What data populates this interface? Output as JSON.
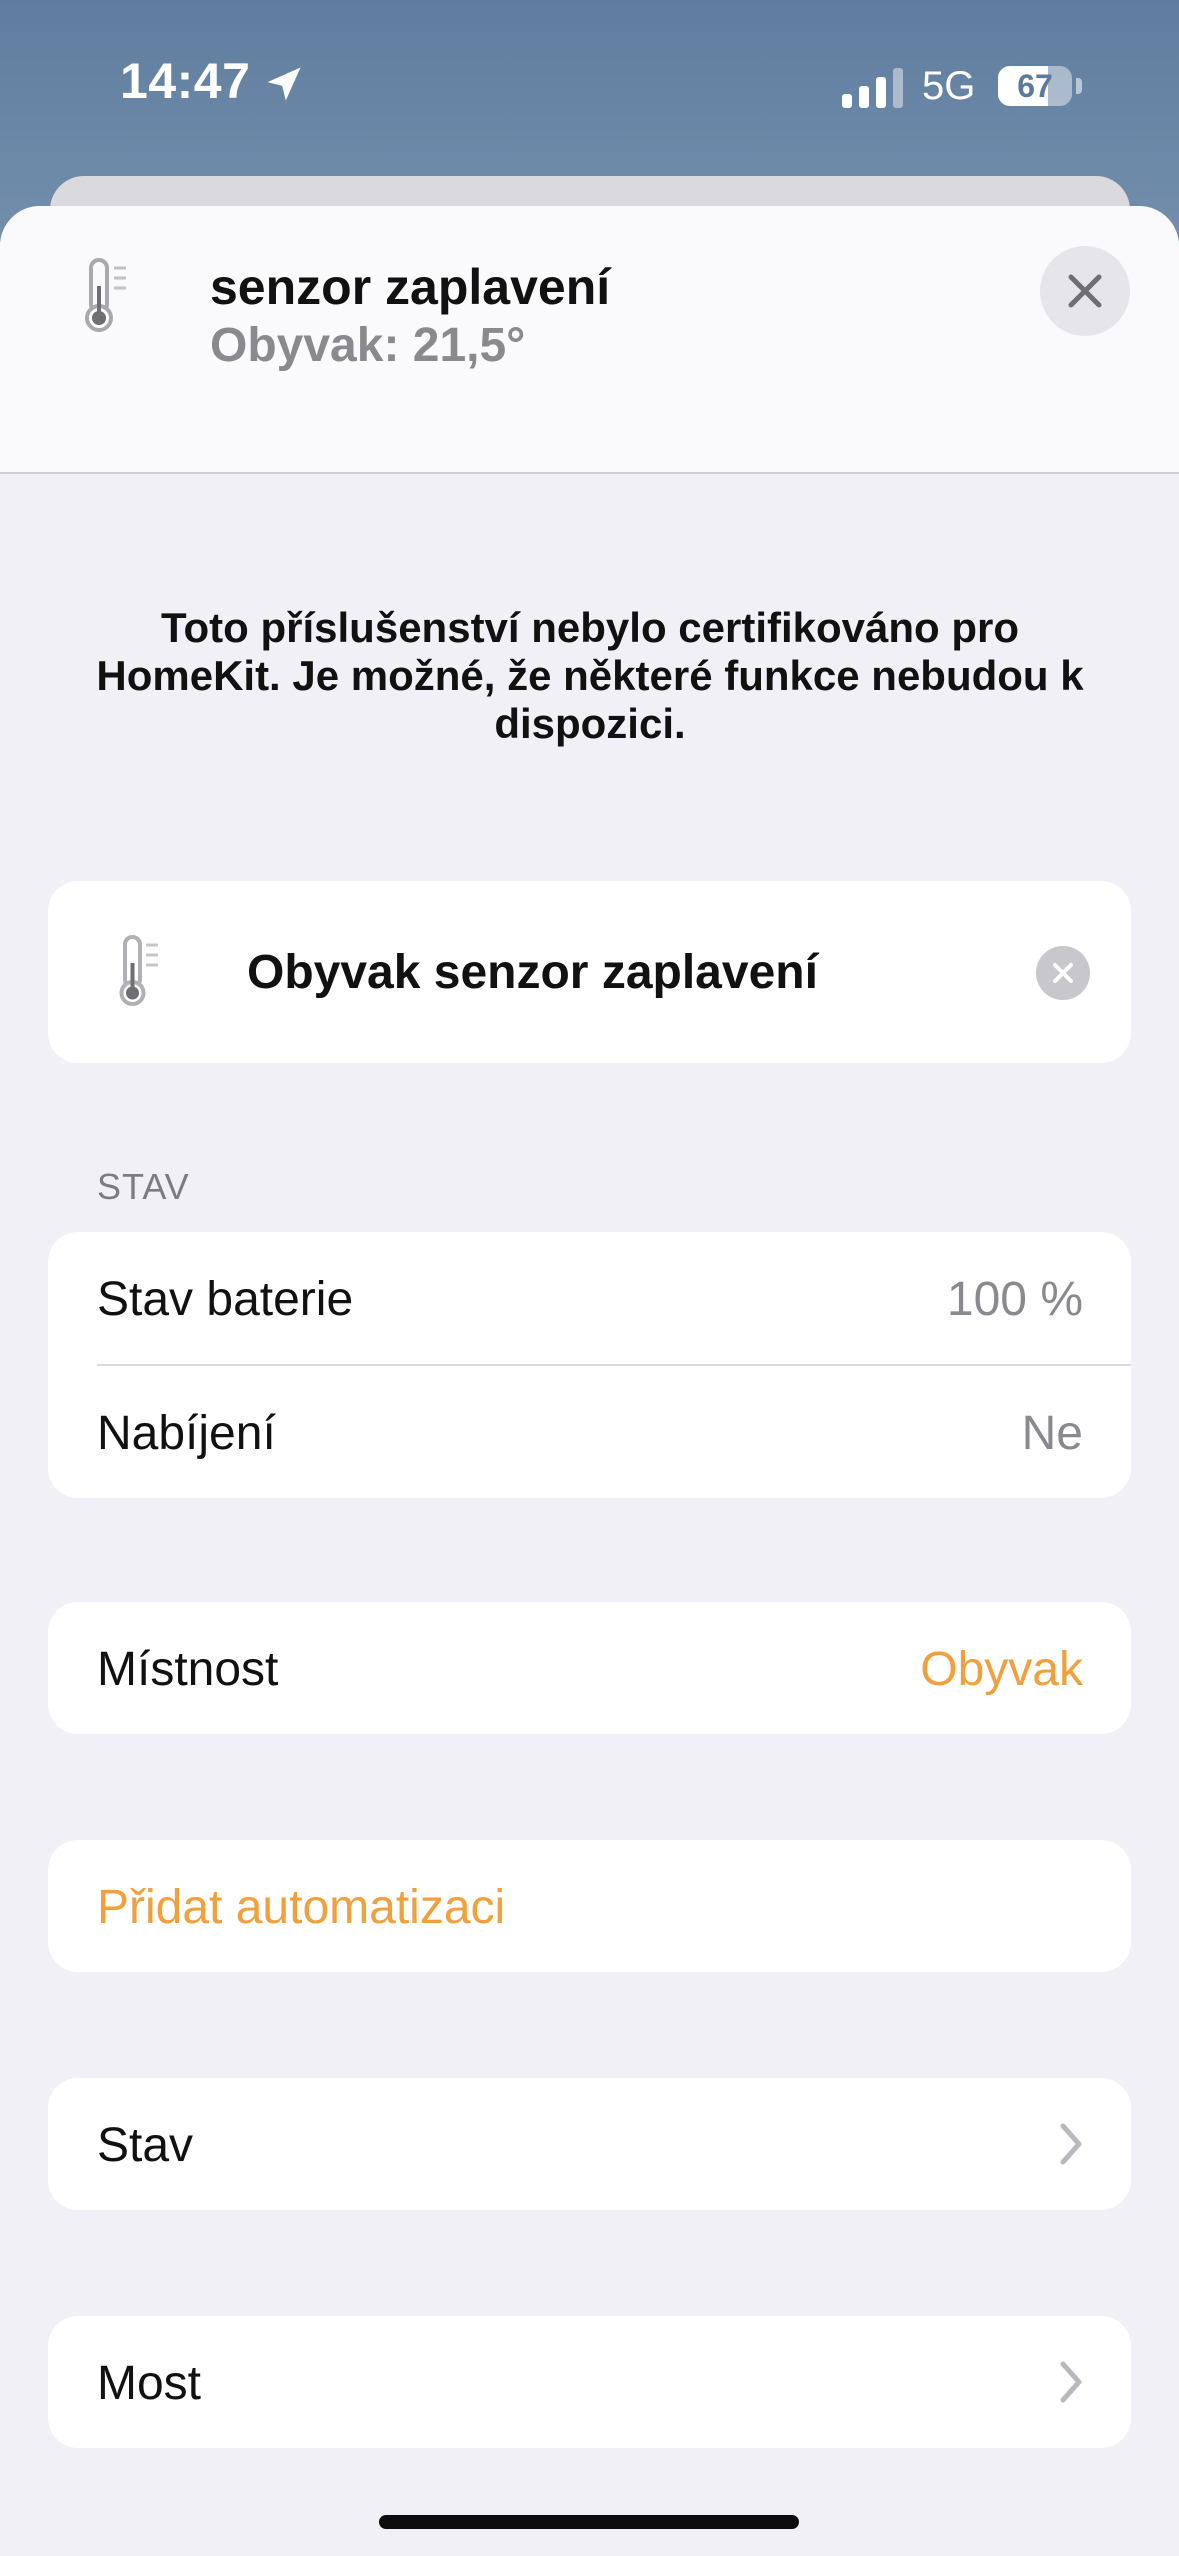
{
  "status_bar": {
    "time": "14:47",
    "network": "5G",
    "battery": "67",
    "battery_level_percent": 67,
    "icons": [
      "location-arrow-icon",
      "cellular-signal-icon",
      "battery-icon"
    ]
  },
  "header": {
    "title": "senzor zaplavení",
    "subtitle": "Obyvak: 21,5°",
    "icon": "thermometer-icon",
    "close_icon": "close-icon"
  },
  "notice": "Toto příslušenství nebylo certifikováno pro HomeKit. Je možné, že některé funkce nebudou k dispozici.",
  "name_card": {
    "name": "Obyvak senzor zaplavení",
    "icon": "thermometer-icon",
    "clear_icon": "clear-icon"
  },
  "status_section": {
    "label": "STAV",
    "rows": [
      {
        "label": "Stav baterie",
        "value": "100 %"
      },
      {
        "label": "Nabíjení",
        "value": "Ne"
      }
    ]
  },
  "room": {
    "label": "Místnost",
    "value": "Obyvak"
  },
  "automation": {
    "label": "Přidat automatizaci"
  },
  "nav_rows": [
    {
      "label": "Stav",
      "icon": "chevron-right-icon"
    },
    {
      "label": "Most",
      "icon": "chevron-right-icon"
    }
  ],
  "colors": {
    "accent": "#f0a03c",
    "background": "#f1f0f6",
    "card": "#ffffff",
    "secondary_text": "#8a8a8e"
  }
}
